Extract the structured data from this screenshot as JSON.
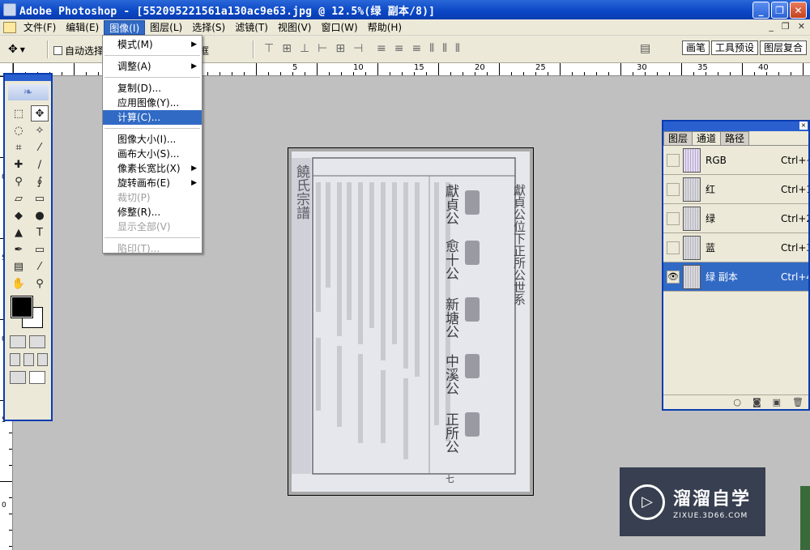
{
  "window": {
    "title": "Adobe Photoshop - [552095221561a130ac9e63.jpg @ 12.5%(绿 副本/8)]",
    "controls": [
      "_",
      "❐",
      "✕"
    ]
  },
  "menubar": {
    "items": [
      "文件(F)",
      "编辑(E)",
      "图像(I)",
      "图层(L)",
      "选择(S)",
      "滤镜(T)",
      "视图(V)",
      "窗口(W)",
      "帮助(H)"
    ],
    "mdi_controls": [
      "_",
      "❐",
      "✕"
    ]
  },
  "options": {
    "auto_select_label": "自动选择",
    "frame_label": "框",
    "palette_well_tabs": [
      "画笔",
      "工具预设",
      "图层复合"
    ]
  },
  "ruler": {
    "h_labels": [
      "5",
      "10",
      "15",
      "20",
      "25",
      "30",
      "35",
      "40"
    ],
    "v_labels": [
      "0",
      "5",
      "0",
      "5",
      "0"
    ]
  },
  "image_menu": {
    "items": [
      {
        "label": "模式(M)",
        "submenu": true,
        "state": "normal"
      },
      {
        "sep": true
      },
      {
        "label": "调整(A)",
        "submenu": true,
        "state": "normal"
      },
      {
        "sep": true
      },
      {
        "label": "复制(D)...",
        "submenu": false,
        "state": "normal"
      },
      {
        "label": "应用图像(Y)...",
        "submenu": false,
        "state": "normal"
      },
      {
        "label": "计算(C)...",
        "submenu": false,
        "state": "highlight"
      },
      {
        "sep": true
      },
      {
        "label": "图像大小(I)...",
        "submenu": false,
        "state": "normal"
      },
      {
        "label": "画布大小(S)...",
        "submenu": false,
        "state": "normal"
      },
      {
        "label": "像素长宽比(X)",
        "submenu": true,
        "state": "normal"
      },
      {
        "label": "旋转画布(E)",
        "submenu": true,
        "state": "normal"
      },
      {
        "label": "裁切(P)",
        "submenu": false,
        "state": "disabled"
      },
      {
        "label": "修整(R)...",
        "submenu": false,
        "state": "normal"
      },
      {
        "label": "显示全部(V)",
        "submenu": false,
        "state": "disabled"
      },
      {
        "sep": true
      },
      {
        "label": "陷印(T)...",
        "submenu": false,
        "state": "disabled"
      }
    ]
  },
  "channels_palette": {
    "tabs": [
      "图层",
      "通道",
      "路径"
    ],
    "active_tab": "通道",
    "channels": [
      {
        "name": "RGB",
        "shortcut": "Ctrl+~",
        "visible": false,
        "selected": false
      },
      {
        "name": "红",
        "shortcut": "Ctrl+1",
        "visible": false,
        "selected": false
      },
      {
        "name": "绿",
        "shortcut": "Ctrl+2",
        "visible": false,
        "selected": false
      },
      {
        "name": "蓝",
        "shortcut": "Ctrl+3",
        "visible": false,
        "selected": false
      },
      {
        "name": "绿 副本",
        "shortcut": "Ctrl+4",
        "visible": true,
        "selected": true
      }
    ]
  },
  "document": {
    "header_right": "獻貞公位下正所公世系",
    "names": [
      "獻貞公",
      "愈十公",
      "新塘公",
      "中溪公",
      "正所公"
    ],
    "side_title": "饒氏宗譜",
    "page_no": "七"
  },
  "watermark": {
    "brand": "溜溜自学",
    "url": "ZIXUE.3D66.COM"
  },
  "colors": {
    "titlebar": "#0a46c4",
    "menu_highlight": "#316ac5",
    "workspace": "#c0c0c0"
  }
}
